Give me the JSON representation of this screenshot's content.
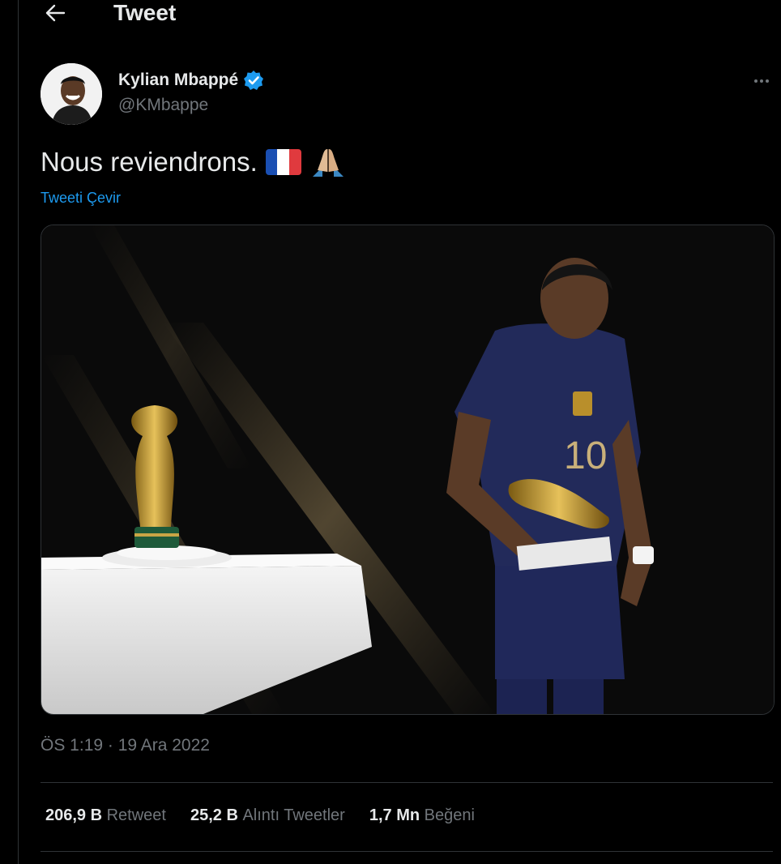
{
  "header": {
    "title": "Tweet",
    "back_icon": "arrow-left-icon"
  },
  "author": {
    "name": "Kylian Mbappé",
    "handle": "@KMbappe",
    "verified": true,
    "verified_color": "#1d9bf0"
  },
  "tweet": {
    "text": "Nous reviendrons.",
    "emojis": [
      "flag-france-icon",
      "folded-hands-icon"
    ],
    "translate_label": "Tweeti Çevir",
    "timestamp": "ÖS 1:19 · 19 Ara 2022"
  },
  "stats": [
    {
      "value": "206,9 B",
      "label": "Retweet"
    },
    {
      "value": "25,2 B",
      "label": "Alıntı Tweetler"
    },
    {
      "value": "1,7 Mn",
      "label": "Beğeni"
    }
  ],
  "colors": {
    "background": "#000000",
    "text": "#e7e9ea",
    "muted": "#71767b",
    "accent": "#1d9bf0",
    "border": "#2f3336"
  }
}
